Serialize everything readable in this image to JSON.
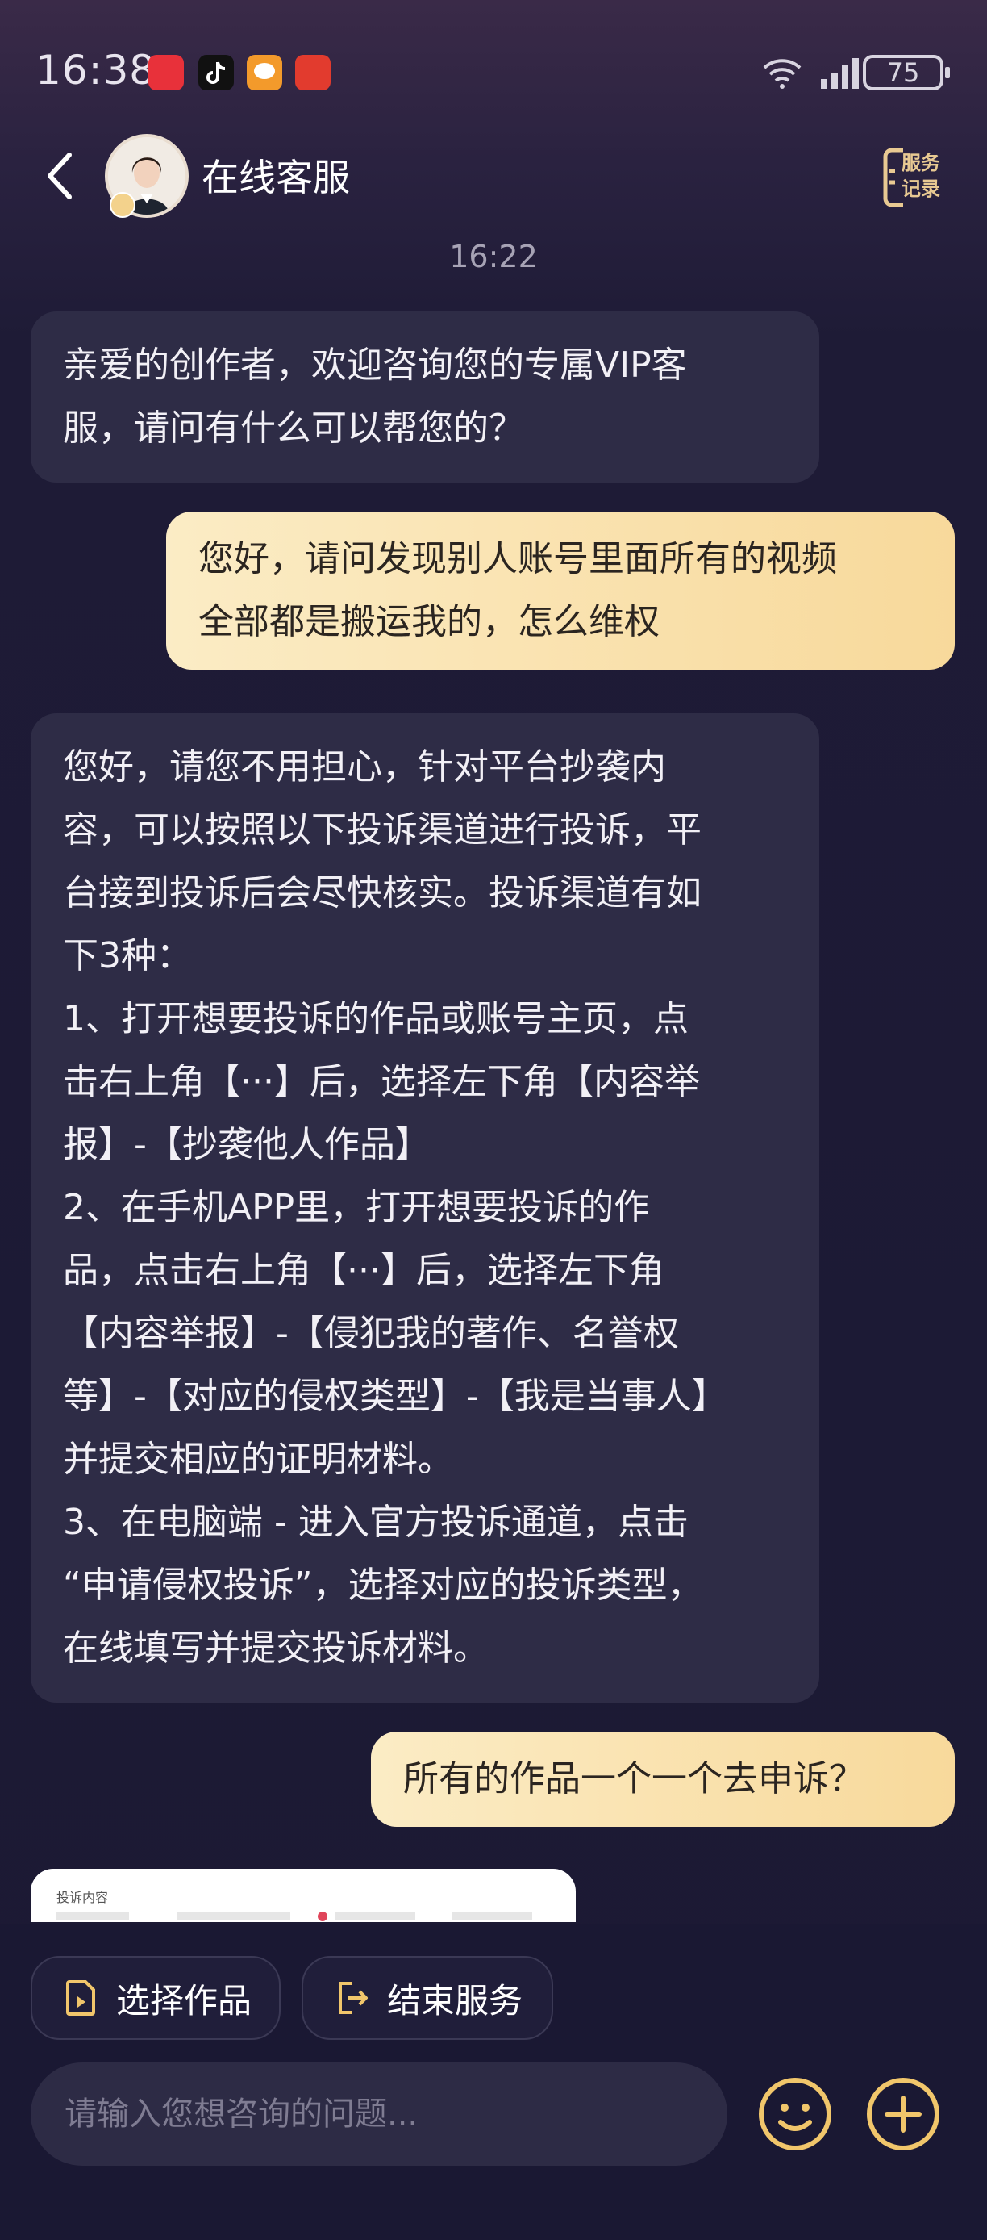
{
  "status_bar": {
    "time": "16:38",
    "battery": "75",
    "icons": [
      "huawei-app-icon",
      "tiktok-icon",
      "chat-app-icon",
      "news-app-icon",
      "wifi-icon",
      "signal-icon",
      "battery-icon"
    ]
  },
  "header": {
    "title": "在线客服",
    "service_record_line1": "服务",
    "service_record_line2": "记录"
  },
  "chat": {
    "timestamp": "16:22",
    "messages": [
      {
        "from": "agent",
        "lines": [
          "亲爱的创作者，欢迎咨询您的专属VIP客",
          "服，请问有什么可以帮您的？"
        ]
      },
      {
        "from": "user",
        "lines": [
          "您好，请问发现别人账号里面所有的视频",
          "全部都是搬运我的，怎么维权"
        ]
      },
      {
        "from": "agent",
        "lines": [
          "您好，请您不用担心，针对平台抄袭内",
          "容，可以按照以下投诉渠道进行投诉，平",
          "台接到投诉后会尽快核实。投诉渠道有如",
          "下3种：",
          "1、打开想要投诉的作品或账号主页，点",
          "击右上角【···】后，选择左下角【内容举",
          "报】-【抄袭他人作品】",
          "2、在手机APP里，打开想要投诉的作",
          "品，点击右上角【···】后，选择左下角",
          "【内容举报】-【侵犯我的著作、名誉权",
          "等】-【对应的侵权类型】-【我是当事人】",
          "并提交相应的证明材料。",
          "3、在电脑端 - 进入官方投诉通道，点击",
          "“申请侵权投诉”，选择对应的投诉类型，",
          "在线填写并提交投诉材料。"
        ]
      },
      {
        "from": "user",
        "lines": [
          "所有的作品一个一个去申诉？"
        ]
      }
    ],
    "image_card_title": "投诉内容"
  },
  "actions": {
    "select_work": "选择作品",
    "end_service": "结束服务"
  },
  "input": {
    "placeholder": "请输入您想咨询的问题...",
    "value": ""
  },
  "colors": {
    "user_bubble": "#f9e0a8",
    "agent_bubble": "#2e2c46",
    "accent_gold": "#e8c992",
    "background": "#1b1934"
  }
}
